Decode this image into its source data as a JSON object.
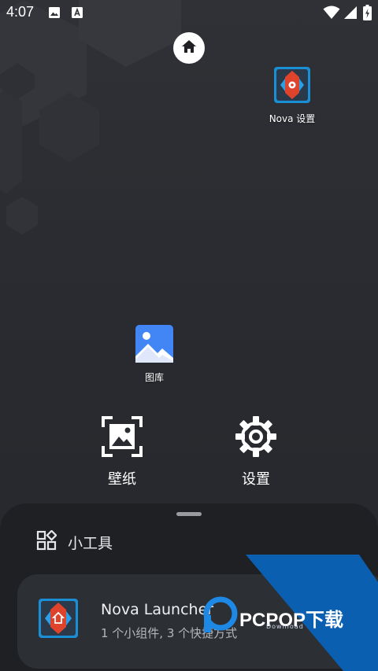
{
  "status_bar": {
    "time": "4:07",
    "icons": [
      "image-icon",
      "font-icon",
      "wifi-icon",
      "cellular-icon",
      "battery-charging-icon"
    ]
  },
  "home_bubble": {
    "icon": "home-icon"
  },
  "desktop": {
    "apps": [
      {
        "id": "nova-settings",
        "label": "Nova 设置",
        "icon": "nova-settings-icon"
      },
      {
        "id": "gallery",
        "label": "图库",
        "icon": "gallery-icon"
      }
    ]
  },
  "long_press_menu": {
    "wallpaper_label": "壁纸",
    "settings_label": "设置"
  },
  "widgets_sheet": {
    "title": "小工具",
    "title_icon": "widgets-icon",
    "items": [
      {
        "title": "Nova Launcher",
        "subtitle": "1 个小组件, 3 个快捷方式",
        "icon": "nova-launcher-icon"
      }
    ]
  },
  "colors": {
    "background": "#2a2c31",
    "sheet": "#1f2023",
    "card": "#2c2f33",
    "nova_red": "#e0432b",
    "nova_blue": "#1a7fd0",
    "watermark_blue": "#0b5fb0"
  },
  "watermark": {
    "text": "PCPOP下载",
    "sub": "Download"
  }
}
